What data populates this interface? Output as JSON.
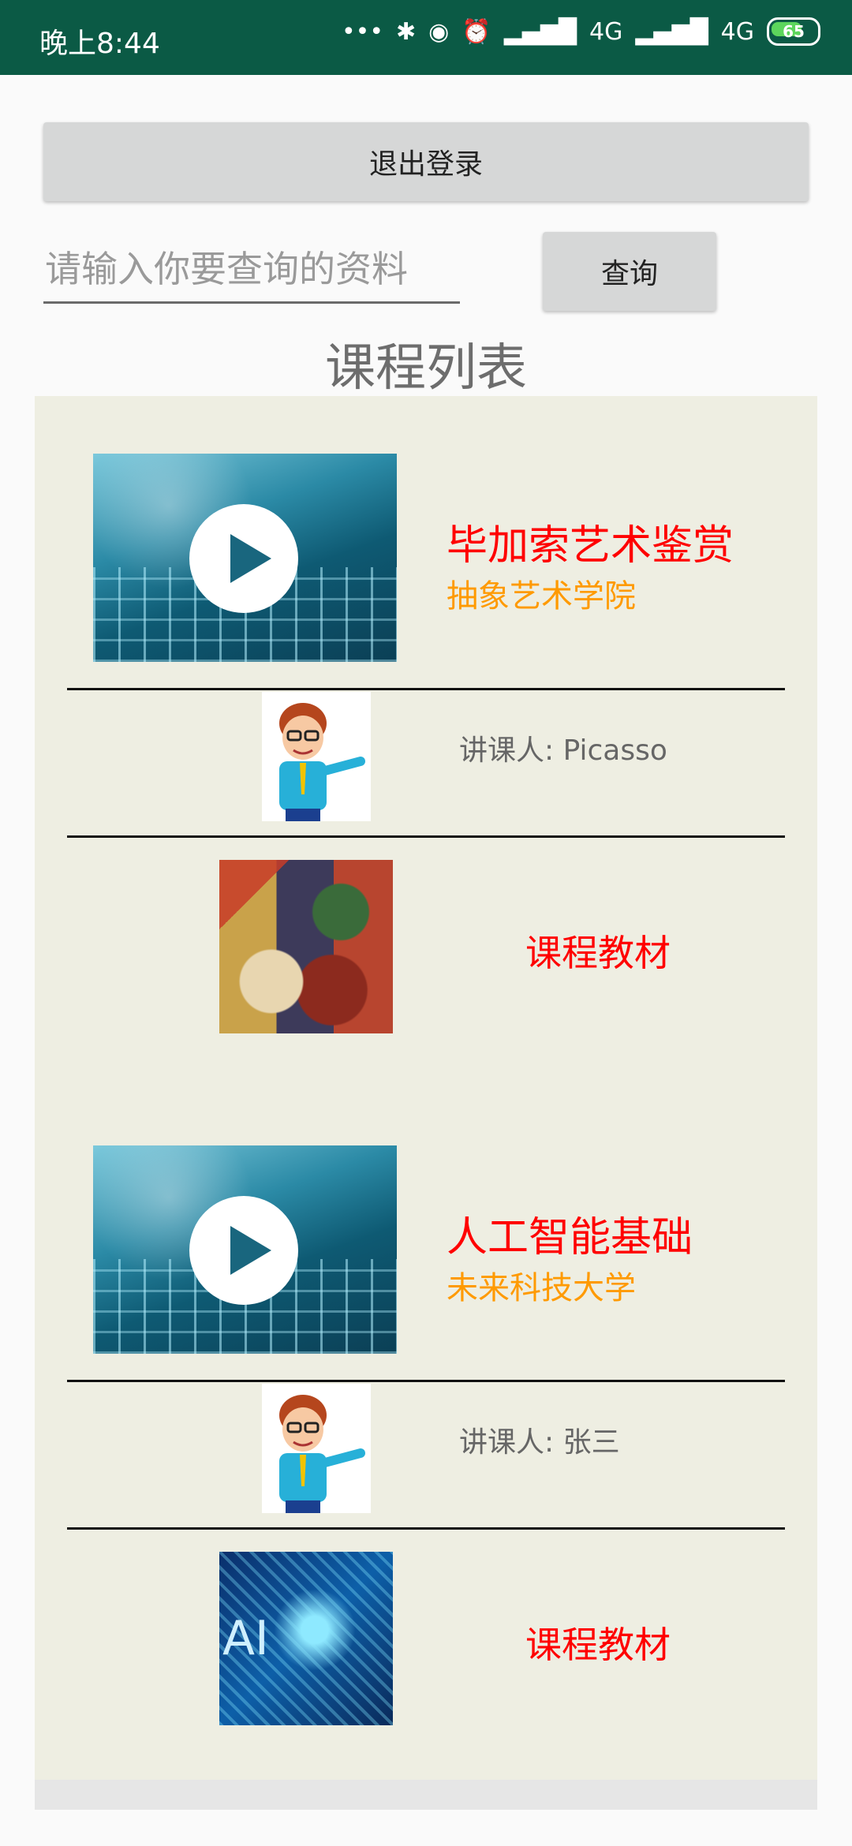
{
  "status_bar": {
    "time": "晚上8:44",
    "icons": [
      "more-dots-icon",
      "bluetooth-icon",
      "toggle-icon",
      "alarm-icon",
      "signal-icon",
      "signal-hd-icon"
    ],
    "network_1": "4G",
    "network_2": "4G",
    "battery": "65"
  },
  "logout_label": "退出登录",
  "search": {
    "placeholder": "请输入你要查询的资料",
    "button_label": "查询"
  },
  "list_title": "课程列表",
  "courses": [
    {
      "name": "毕加索艺术鉴赏",
      "school": "抽象艺术学院",
      "teacher": "讲课人:  Picasso",
      "material_label": "课程教材"
    },
    {
      "name": "人工智能基础",
      "school": "未来科技大学",
      "teacher": "讲课人:  张三",
      "material_label": "课程教材",
      "material_image_text": "AI"
    }
  ],
  "colors": {
    "status_bar": "#0b5a45",
    "course_name": "#ff0000",
    "course_school": "#ff9a00",
    "panel_bg": "#eeeee2"
  }
}
